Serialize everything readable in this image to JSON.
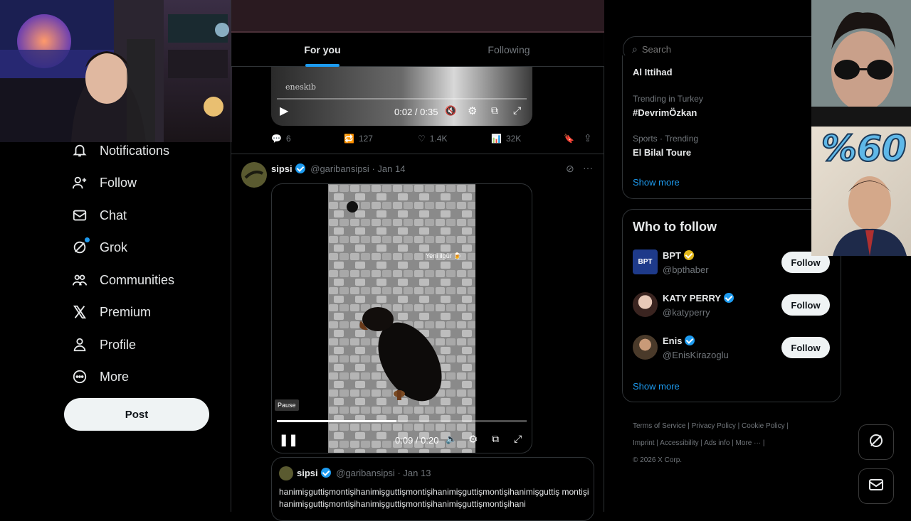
{
  "nav": {
    "items": [
      {
        "label": "Notifications",
        "icon": "bell-icon"
      },
      {
        "label": "Follow",
        "icon": "person-add-icon"
      },
      {
        "label": "Chat",
        "icon": "envelope-icon"
      },
      {
        "label": "Grok",
        "icon": "grok-icon"
      },
      {
        "label": "Communities",
        "icon": "people-icon"
      },
      {
        "label": "Premium",
        "icon": "x-logo-icon"
      },
      {
        "label": "Profile",
        "icon": "person-icon"
      },
      {
        "label": "More",
        "icon": "more-circle-icon"
      }
    ],
    "post_label": "Post"
  },
  "tabs": {
    "for_you": "For you",
    "following": "Following"
  },
  "tweet1": {
    "video_time": "0:02 / 0:35",
    "watermark": "eneskib",
    "replies": "6",
    "reposts": "127",
    "likes": "1.4K",
    "views": "32K"
  },
  "tweet2": {
    "name": "sipsi",
    "handle": "@garibansipsi",
    "date": "· Jan 14",
    "video_time": "0:09 / 0:20",
    "pause_tooltip": "Pause",
    "video_caption": "Yeni ilgür 🍺",
    "progress": 0.48
  },
  "quote": {
    "name": "sipsi",
    "handle": "@garibansipsi",
    "date": "· Jan 13",
    "text": "hanimişguttişmontişihanimişguttişmontişihanimişguttişmontişihanimişguttiş montişihanimişguttişmontişihanimişguttişmontişihanimişguttişmontişihani"
  },
  "search": {
    "placeholder": "Search"
  },
  "trends": [
    {
      "category": "",
      "title": "Al Ittihad"
    },
    {
      "category": "Trending in Turkey",
      "title": "#DevrimÖzkan"
    },
    {
      "category": "Sports · Trending",
      "title": "El Bilal Toure"
    }
  ],
  "trends_show_more": "Show more",
  "who_to_follow": {
    "title": "Who to follow",
    "accounts": [
      {
        "name": "BPT",
        "handle": "@bpthaber",
        "badge": "gold",
        "avatar_text": "BPT"
      },
      {
        "name": "KATY PERRY",
        "handle": "@katyperry",
        "badge": "blue"
      },
      {
        "name": "Enis",
        "handle": "@EnisKirazoglu",
        "badge": "blue"
      }
    ],
    "follow_label": "Follow",
    "show_more": "Show more"
  },
  "footer": {
    "links": [
      "Terms of Service",
      "Privacy Policy",
      "Cookie Policy",
      "Imprint",
      "Accessibility",
      "Ads info",
      "More ···"
    ],
    "copyright": "© 2026 X Corp."
  },
  "overlay": {
    "percent_text": "%60"
  },
  "colors": {
    "accent": "#1d9bf0",
    "bg": "#000000",
    "border": "#2f3336",
    "muted": "#71767b"
  }
}
